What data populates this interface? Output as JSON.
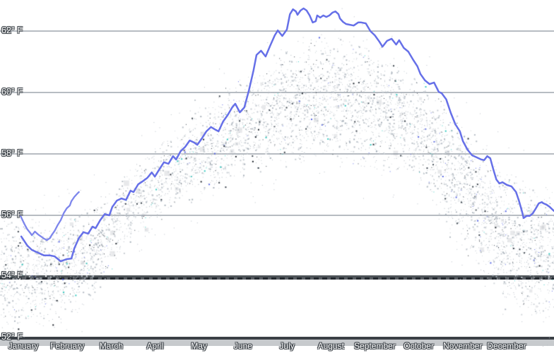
{
  "chart_data": {
    "type": "line+scatter",
    "title": "",
    "legend": "none",
    "grid": "horizontal",
    "y_axis": {
      "unit": "° F",
      "min": 52,
      "max": 63,
      "ticks": [
        {
          "label": "62° F",
          "value": 62,
          "style": "light"
        },
        {
          "label": "60° F",
          "value": 60,
          "style": "light"
        },
        {
          "label": "58° F",
          "value": 58,
          "style": "light"
        },
        {
          "label": "56° F",
          "value": 56,
          "style": "light"
        },
        {
          "label": "54° F",
          "value": 54,
          "style": "dark-dashed"
        },
        {
          "label": "52° F",
          "value": 52,
          "style": "axis"
        }
      ]
    },
    "x_axis": {
      "unit": "day-of-year",
      "range": [
        0,
        365
      ],
      "months": [
        "January",
        "February",
        "March",
        "April",
        "May",
        "June",
        "July",
        "August",
        "September",
        "October",
        "November",
        "December"
      ]
    },
    "series": [
      {
        "name": "temperature-line",
        "color": "#6670e8",
        "width": 2.5,
        "points_day_tempF": [
          [
            14,
            55.3
          ],
          [
            18,
            55.0
          ],
          [
            21,
            54.86
          ],
          [
            25,
            54.77
          ],
          [
            29,
            54.68
          ],
          [
            33,
            54.68
          ],
          [
            36,
            54.65
          ],
          [
            40,
            54.49
          ],
          [
            44,
            54.56
          ],
          [
            47,
            54.58
          ],
          [
            49,
            54.91
          ],
          [
            52,
            55.25
          ],
          [
            55,
            55.44
          ],
          [
            58,
            55.39
          ],
          [
            61,
            55.62
          ],
          [
            63,
            55.57
          ],
          [
            66,
            55.83
          ],
          [
            69,
            56.03
          ],
          [
            72,
            55.99
          ],
          [
            74,
            56.26
          ],
          [
            77,
            56.47
          ],
          [
            80,
            56.54
          ],
          [
            83,
            56.49
          ],
          [
            86,
            56.79
          ],
          [
            88,
            56.75
          ],
          [
            91,
            57.0
          ],
          [
            94,
            57.1
          ],
          [
            97,
            57.21
          ],
          [
            100,
            57.39
          ],
          [
            102,
            57.25
          ],
          [
            105,
            57.49
          ],
          [
            108,
            57.72
          ],
          [
            111,
            57.67
          ],
          [
            114,
            57.92
          ],
          [
            116,
            57.81
          ],
          [
            119,
            58.08
          ],
          [
            122,
            58.22
          ],
          [
            125,
            58.43
          ],
          [
            128,
            58.36
          ],
          [
            130,
            58.29
          ],
          [
            133,
            58.5
          ],
          [
            136,
            58.73
          ],
          [
            139,
            58.87
          ],
          [
            142,
            58.78
          ],
          [
            144,
            58.73
          ],
          [
            147,
            59.05
          ],
          [
            150,
            59.26
          ],
          [
            153,
            59.51
          ],
          [
            155,
            59.63
          ],
          [
            158,
            59.35
          ],
          [
            161,
            59.51
          ],
          [
            164,
            60.07
          ],
          [
            167,
            60.71
          ],
          [
            169,
            61.22
          ],
          [
            172,
            61.36
          ],
          [
            175,
            61.17
          ],
          [
            178,
            61.52
          ],
          [
            181,
            61.86
          ],
          [
            183,
            62.02
          ],
          [
            186,
            61.84
          ],
          [
            189,
            62.05
          ],
          [
            191,
            62.55
          ],
          [
            193,
            62.71
          ],
          [
            195,
            62.64
          ],
          [
            196,
            62.53
          ],
          [
            198,
            62.67
          ],
          [
            200,
            62.74
          ],
          [
            202,
            62.67
          ],
          [
            204,
            62.51
          ],
          [
            206,
            62.28
          ],
          [
            208,
            62.32
          ],
          [
            209,
            62.51
          ],
          [
            211,
            62.44
          ],
          [
            213,
            62.51
          ],
          [
            215,
            62.46
          ],
          [
            217,
            62.51
          ],
          [
            219,
            62.6
          ],
          [
            221,
            62.64
          ],
          [
            223,
            62.55
          ],
          [
            224,
            62.41
          ],
          [
            226,
            62.3
          ],
          [
            228,
            62.23
          ],
          [
            230,
            62.21
          ],
          [
            233,
            62.18
          ],
          [
            236,
            62.28
          ],
          [
            238,
            62.28
          ],
          [
            241,
            62.25
          ],
          [
            244,
            62.0
          ],
          [
            247,
            61.86
          ],
          [
            250,
            61.65
          ],
          [
            252,
            61.49
          ],
          [
            255,
            61.68
          ],
          [
            258,
            61.75
          ],
          [
            261,
            61.56
          ],
          [
            263,
            61.7
          ],
          [
            266,
            61.45
          ],
          [
            269,
            61.33
          ],
          [
            272,
            61.08
          ],
          [
            275,
            60.85
          ],
          [
            277,
            60.6
          ],
          [
            280,
            60.39
          ],
          [
            283,
            60.27
          ],
          [
            286,
            60.32
          ],
          [
            289,
            60.02
          ],
          [
            291,
            59.97
          ],
          [
            294,
            59.77
          ],
          [
            297,
            59.33
          ],
          [
            300,
            58.96
          ],
          [
            303,
            58.73
          ],
          [
            305,
            58.41
          ],
          [
            308,
            58.13
          ],
          [
            311,
            57.95
          ],
          [
            314,
            57.88
          ],
          [
            317,
            57.81
          ],
          [
            319,
            57.79
          ],
          [
            321,
            57.92
          ],
          [
            323,
            57.85
          ],
          [
            325,
            57.49
          ],
          [
            327,
            57.16
          ],
          [
            329,
            57.03
          ],
          [
            331,
            57.07
          ],
          [
            334,
            56.98
          ],
          [
            337,
            56.93
          ],
          [
            340,
            56.75
          ],
          [
            342,
            56.45
          ],
          [
            344,
            56.1
          ],
          [
            345,
            55.9
          ],
          [
            347,
            55.97
          ],
          [
            349,
            55.97
          ],
          [
            351,
            56.05
          ],
          [
            353,
            56.21
          ],
          [
            355,
            56.38
          ],
          [
            357,
            56.42
          ],
          [
            358,
            56.38
          ],
          [
            360,
            56.34
          ],
          [
            362,
            56.27
          ],
          [
            365,
            56.13
          ]
        ]
      },
      {
        "name": "secondary-line-segment",
        "color": "#7d86ec",
        "width": 2.3,
        "points_day_tempF": [
          [
            12,
            56.1
          ],
          [
            14,
            55.92
          ],
          [
            16,
            55.71
          ],
          [
            18,
            55.53
          ],
          [
            20,
            55.41
          ],
          [
            21,
            55.34
          ],
          [
            23,
            55.46
          ],
          [
            25,
            55.37
          ],
          [
            27,
            55.3
          ],
          [
            29,
            55.23
          ],
          [
            31,
            55.18
          ],
          [
            33,
            55.25
          ],
          [
            34,
            55.34
          ],
          [
            36,
            55.48
          ],
          [
            38,
            55.67
          ],
          [
            40,
            55.83
          ],
          [
            42,
            56.06
          ],
          [
            44,
            56.22
          ],
          [
            46,
            56.31
          ],
          [
            47,
            56.45
          ],
          [
            49,
            56.59
          ],
          [
            51,
            56.7
          ],
          [
            52,
            56.75
          ]
        ]
      }
    ],
    "scatter_band": {
      "description": "dense cloud of historical daily observation dots following the seasonal curve",
      "nodes_day_topF_bottomF": [
        [
          0,
          56.22,
          52.07
        ],
        [
          30,
          56.1,
          52.19
        ],
        [
          61,
          56.56,
          53.11
        ],
        [
          91,
          57.83,
          55.41
        ],
        [
          121,
          59.21,
          56.22
        ],
        [
          151,
          60.25,
          56.91
        ],
        [
          182,
          61.4,
          57.37
        ],
        [
          212,
          62.05,
          57.67
        ],
        [
          242,
          61.91,
          57.26
        ],
        [
          272,
          60.83,
          57.14
        ],
        [
          303,
          59.56,
          54.72
        ],
        [
          333,
          57.6,
          52.76
        ],
        [
          365,
          56.91,
          52.19
        ]
      ],
      "dot_count": 6200,
      "dot_colors": {
        "base1": "#c6ccd2",
        "base2": "#b7bec6",
        "base3": "#d2d7db",
        "base4": "#a9b2bb",
        "white": "#ffffff",
        "dark": "#39424b",
        "darker": "#20262e",
        "teal": "#35c9c0",
        "blue": "#5a68e4"
      }
    }
  },
  "colors": {
    "background": "#ffffff",
    "gridline_light": "#b7bcc2",
    "gridline_dark": "#3b4046",
    "axis_band": "#c7cacd",
    "label_fill": "#ffffff",
    "label_outline": "#3a4046"
  }
}
